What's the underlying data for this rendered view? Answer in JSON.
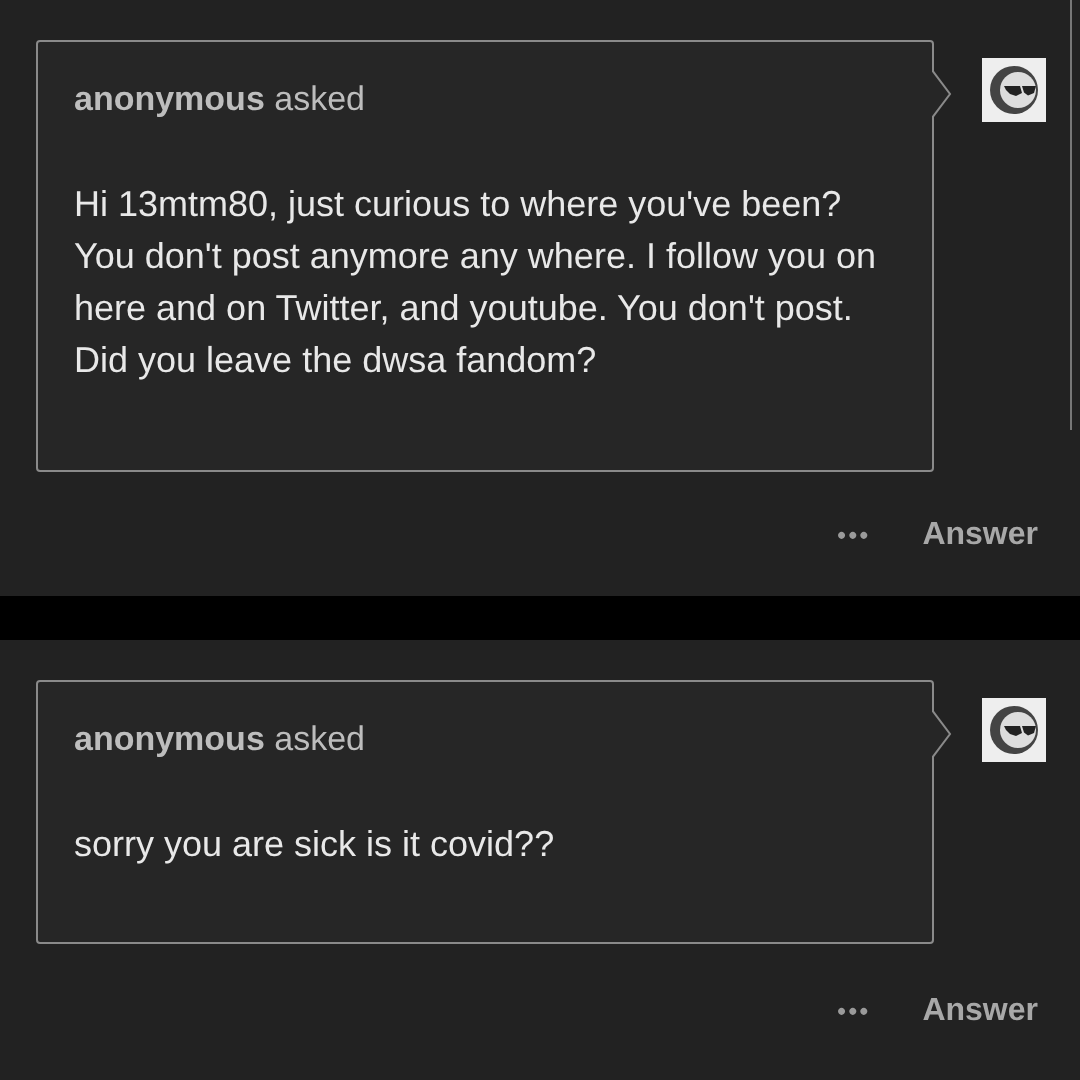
{
  "posts": [
    {
      "asker": "anonymous",
      "verb": "asked",
      "question": "Hi 13mtm80, just curious to where you've been? You don't post anymore any where. I follow you on here and on Twitter, and youtube. You don't post. Did you leave the dwsa fandom?",
      "more": "•••",
      "action": "Answer"
    },
    {
      "asker": "anonymous",
      "verb": "asked",
      "question": "sorry you are sick is it covid??",
      "more": "•••",
      "action": "Answer"
    }
  ]
}
